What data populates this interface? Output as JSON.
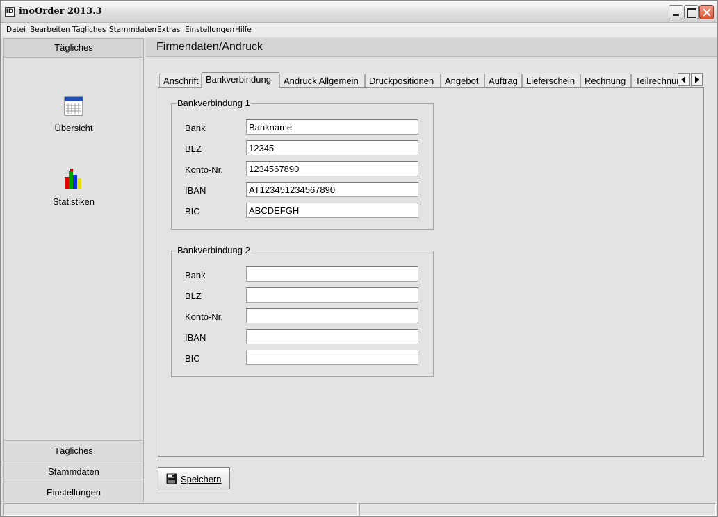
{
  "window": {
    "title": "inoOrder 2013.3"
  },
  "menu": {
    "items": [
      "Datei",
      "Bearbeiten",
      "Tägliches",
      "Stammdaten",
      "Extras",
      "Einstellungen",
      "Hilfe"
    ]
  },
  "sidebar": {
    "header": "Tägliches",
    "tiles": [
      {
        "label": "Übersicht",
        "icon": "calendar-icon"
      },
      {
        "label": "Statistiken",
        "icon": "bar-chart-icon"
      }
    ],
    "bottom_buttons": [
      "Tägliches",
      "Stammdaten",
      "Einstellungen"
    ]
  },
  "page": {
    "title": "Firmendaten/Andruck"
  },
  "tabs": {
    "items": [
      "Anschrift",
      "Bankverbindung",
      "Andruck Allgemein",
      "Druckpositionen",
      "Angebot",
      "Auftrag",
      "Lieferschein",
      "Rechnung",
      "Teilrechnung"
    ],
    "active": "Bankverbindung"
  },
  "bank1": {
    "legend": "Bankverbindung 1",
    "labels": [
      "Bank",
      "BLZ",
      "Konto-Nr.",
      "IBAN",
      "BIC"
    ],
    "values": [
      "Bankname",
      "12345",
      "1234567890",
      "AT123451234567890",
      "ABCDEFGH"
    ]
  },
  "bank2": {
    "legend": "Bankverbindung 2",
    "labels": [
      "Bank",
      "BLZ",
      "Konto-Nr.",
      "IBAN",
      "BIC"
    ],
    "values": [
      "",
      "",
      "",
      "",
      ""
    ]
  },
  "actions": {
    "save_label": "Speichern"
  },
  "colors": {
    "calendar_header": "#1f4fb3",
    "chart_bars": [
      "#e00000",
      "#00a000",
      "#1030e0",
      "#e8e000"
    ]
  }
}
